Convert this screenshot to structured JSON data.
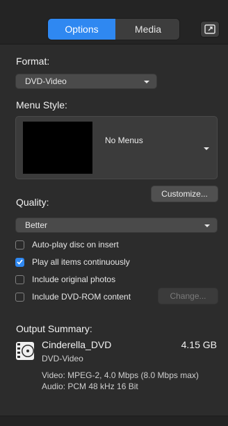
{
  "tabs": {
    "options": "Options",
    "media": "Media"
  },
  "format": {
    "label": "Format:",
    "value": "DVD-Video"
  },
  "menu_style": {
    "label": "Menu Style:",
    "value": "No Menus"
  },
  "customize_button": "Customize...",
  "quality": {
    "label": "Quality:",
    "value": "Better"
  },
  "checkboxes": [
    {
      "label": "Auto-play disc on insert",
      "checked": false
    },
    {
      "label": "Play all items continuously",
      "checked": true
    },
    {
      "label": "Include original photos",
      "checked": false
    },
    {
      "label": "Include DVD-ROM content",
      "checked": false
    }
  ],
  "change_button": "Change...",
  "summary": {
    "heading": "Output Summary:",
    "title": "Cinderella_DVD",
    "size": "4.15 GB",
    "format": "DVD-Video",
    "video": "Video: MPEG-2, 4.0 Mbps (8.0 Mbps max)",
    "audio": "Audio: PCM 48 kHz 16 Bit"
  },
  "colors": {
    "accent": "#2f88f1",
    "background": "#2c2c2c"
  }
}
